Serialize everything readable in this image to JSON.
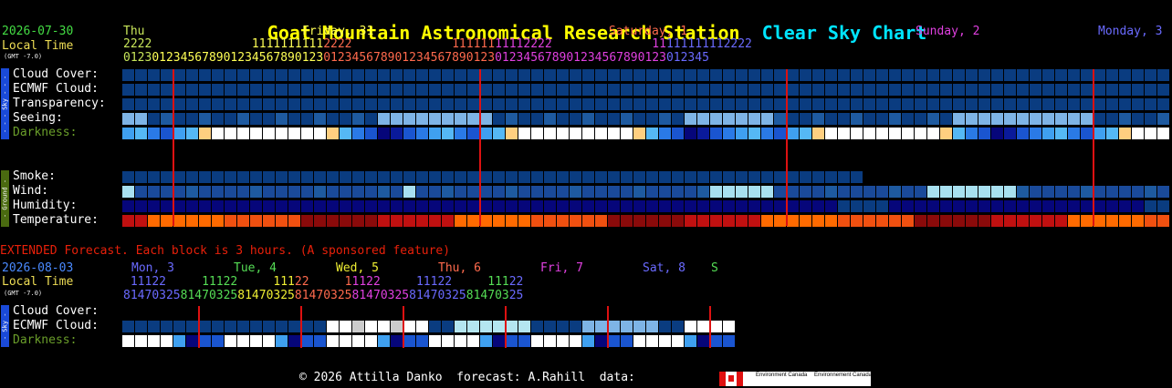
{
  "title": {
    "station": "Goat Mountain Astronomical Research Station",
    "chart": "Clear Sky Chart"
  },
  "main": {
    "date": "2026-07-30",
    "local_time": "Local Time",
    "gmt": "(GMT -7.0)",
    "days": [
      {
        "label": "Thu",
        "color": "#c8e65a"
      },
      {
        "label": "Friday, 31",
        "color": "#ffff55"
      },
      {
        "label": "Saturday, 1",
        "color": "#ff6a4d"
      },
      {
        "label": "Sunday, 2",
        "color": "#e040e0"
      },
      {
        "label": "Monday, 3",
        "color": "#6a6aff"
      }
    ],
    "tens_row": "2222              11111111112222              11111111112222              11111111112222",
    "hours_row": "0123012345678901234567890123012345678901234567890123012345678901234567890123012345",
    "sky_rows": [
      "Cloud Cover:",
      "ECMWF Cloud:",
      "Transparency:",
      "Seeing:",
      "Darkness:"
    ],
    "ground_rows": [
      "Smoke:",
      "Wind:",
      "Humidity:",
      "Temperature:"
    ],
    "sky_side": "- - - Sky - - -",
    "ground_side": "- Ground -"
  },
  "extended": {
    "heading": "EXTENDED Forecast. Each block is 3 hours. (A sponsored feature)",
    "date": "2026-08-03",
    "local_time": "Local Time",
    "gmt": "(GMT -7.0)",
    "days": [
      {
        "label": "Mon, 3",
        "color": "#6a6aff"
      },
      {
        "label": "Tue, 4",
        "color": "#55dd55"
      },
      {
        "label": "Wed, 5",
        "color": "#eeee33"
      },
      {
        "label": "Thu, 6",
        "color": "#ff6a4d"
      },
      {
        "label": "Fri, 7",
        "color": "#e040e0"
      },
      {
        "label": "Sat, 8",
        "color": "#6a6aff"
      },
      {
        "label": "S",
        "color": "#55dd55"
      }
    ],
    "tens_row": " 11122     11122     11122     11122     11122     11122",
    "hours_row": "81470325814703258147032581470325814703258147032581470325",
    "rows": [
      "Cloud Cover:",
      "ECMWF Cloud:",
      "Darkness:"
    ],
    "side": "- Sky -"
  },
  "footer": {
    "credit": "© 2026 Attilla Danko  forecast: A.Rahill  data:",
    "env1": "Environment Canada",
    "env2": "Environnement Canada"
  },
  "colors": {
    "cloud_dark": "#0a3c80",
    "cloud_mid": "#1e5aa0",
    "seeing_light": "#7eb4e6",
    "dark_navy": "#06067a",
    "temp_red": "#e8300a",
    "temp_orange": "#ff6a00",
    "line_red": "#d11111"
  }
}
